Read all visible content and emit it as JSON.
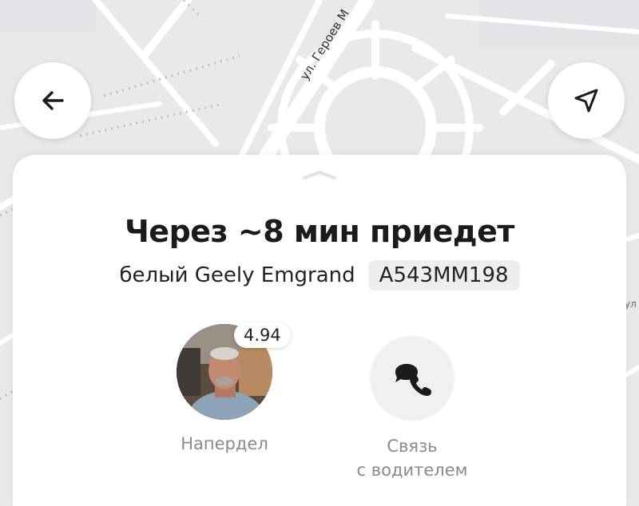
{
  "map": {
    "street_name": "ул. Героев М",
    "edge_label": "ул"
  },
  "nav": {
    "back_icon": "arrow-left-icon",
    "locate_icon": "navigation-arrow-icon"
  },
  "ride": {
    "title": "Через ~8 мин приедет",
    "car_description": "белый Geely Emgrand",
    "plate": "А543ММ198"
  },
  "driver": {
    "name": "Напердел",
    "rating": "4.94"
  },
  "contact": {
    "label_line1": "Связь",
    "label_line2": "с водителем",
    "icon": "phone-chat-icon"
  },
  "colors": {
    "map_bg": "#e9e9ec",
    "road": "#ffffff",
    "sheet": "#ffffff",
    "plate_bg": "#eeeeee",
    "secondary_text": "#8a8a8a"
  }
}
